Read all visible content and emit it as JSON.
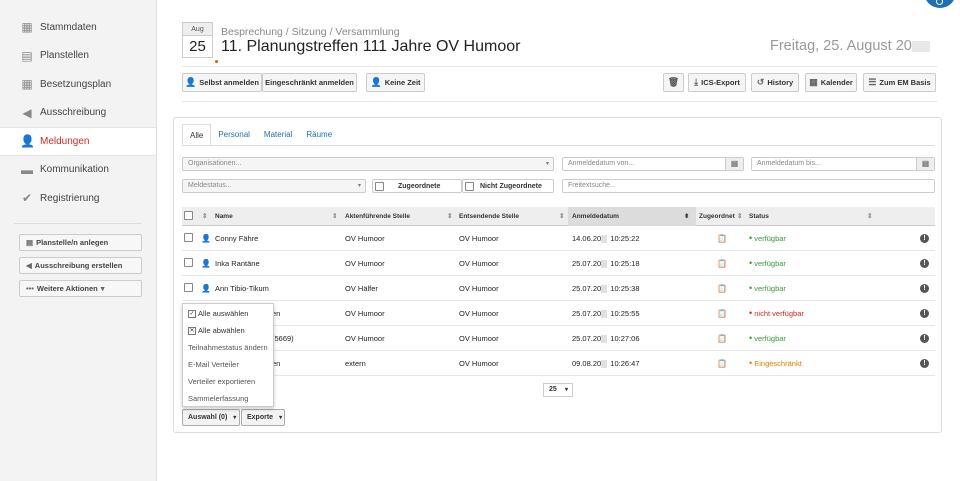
{
  "sidebar": {
    "items": [
      {
        "label": "Stammdaten",
        "icon": "calendar-grid-icon"
      },
      {
        "label": "Planstellen",
        "icon": "clipboard-icon"
      },
      {
        "label": "Besetzungsplan",
        "icon": "table-icon"
      },
      {
        "label": "Ausschreibung",
        "icon": "megaphone-icon"
      },
      {
        "label": "Meldungen",
        "icon": "user-report-icon"
      },
      {
        "label": "Kommunikation",
        "icon": "chat-icon"
      },
      {
        "label": "Registrierung",
        "icon": "checklist-icon"
      }
    ],
    "actions": {
      "add_position": "Planstelle/n anlegen",
      "create_posting": "Ausschreibung erstellen",
      "more_actions": "Weitere Aktionen"
    }
  },
  "event": {
    "month": "Aug",
    "day": "25",
    "breadcrumb": "Besprechung / Sitzung / Versammlung",
    "title": "11. Planungstreffen 111 Jahre OV Humoor",
    "date": "Freitag, 25. August 20"
  },
  "toolbar": {
    "self_register": "Selbst anmelden",
    "limited_register": "Eingeschränkt  anmelden",
    "no_time": "Keine Zeit",
    "ics_export": "ICS-Export",
    "history": "History",
    "calendar": "Kalender",
    "to_basis": "Zum EM Basis"
  },
  "tabs": [
    "Alle",
    "Personal",
    "Material",
    "Räume"
  ],
  "filters": {
    "organisations": "Organisationen...",
    "registered_from": "Anmeldedatum von...",
    "registered_to": "Anmeldedatum bis...",
    "report_status": "Meldestatus...",
    "assigned": "Zugeordnete",
    "not_assigned": "Nicht Zugeordnete",
    "free_text": "Freitextsuche..."
  },
  "table": {
    "headers": [
      "Name",
      "Aktenführende Stelle",
      "Entsendende Stelle",
      "Anmeldedatum",
      "Zugeordnet",
      "Status"
    ],
    "rows": [
      {
        "name": "Conny Fähre",
        "stelle": "OV Humoor",
        "entsendend": "OV Humoor",
        "date": "14.06.20",
        "time": "10:25:22",
        "status": "verfügbar",
        "status_kind": "ok"
      },
      {
        "name": "Inka Rantäne",
        "stelle": "OV Humoor",
        "entsendend": "OV Humoor",
        "date": "25.07.20",
        "time": "10:25:18",
        "status": "verfügbar",
        "status_kind": "ok"
      },
      {
        "name": "Ann Tibio-Tikum",
        "stelle": "OV Hälfer",
        "entsendend": "OV Humoor",
        "date": "25.07.20",
        "time": "10:25:38",
        "status": "verfügbar",
        "status_kind": "ok"
      },
      {
        "name": "en",
        "stelle": "OV Humoor",
        "entsendend": "OV Humoor",
        "date": "25.07.20",
        "time": "10:25:55",
        "status": "nicht verfügbar",
        "status_kind": "no"
      },
      {
        "name": "(5669)",
        "stelle": "OV Humoor",
        "entsendend": "OV Humoor",
        "date": "25.07.20",
        "time": "10:27:06",
        "status": "verfügbar",
        "status_kind": "ok"
      },
      {
        "name": "en",
        "stelle": "extern",
        "entsendend": "OV Humoor",
        "date": "09.08.20",
        "time": "10:26:47",
        "status": "Eingeschränkt",
        "status_kind": "lim"
      }
    ]
  },
  "dropdown_menu": {
    "items": [
      "Alle auswählen",
      "Alle abwählen",
      "Teilnahmestatus ändern",
      "E-Mail Verteiler",
      "Verteiler exportieren",
      "Sammelerfassung"
    ]
  },
  "pager": {
    "page_size": "25"
  },
  "bottom": {
    "selection": "Auswahl (0)",
    "exports": "Exporte"
  },
  "colors": {
    "accent": "#1f6fb2",
    "active_nav": "#d0291d",
    "ok": "#3a9a3a",
    "limited": "#e67e00"
  }
}
